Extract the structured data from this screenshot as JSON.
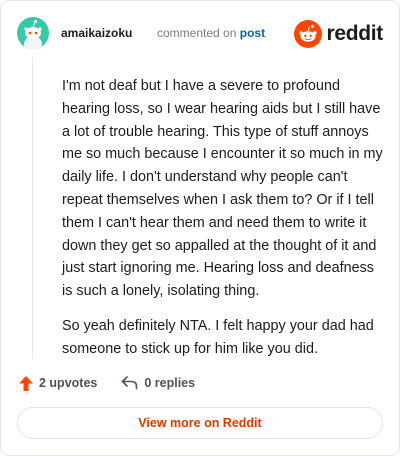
{
  "comment": {
    "author": "amaikaizoku",
    "action_text": "commented on",
    "post_link_label": "post",
    "paragraphs": [
      "I'm not deaf but I have a severe to profound hearing loss, so I wear hearing aids but I still have a lot of trouble hearing. This type of stuff annoys me so much because I encounter it so much in my daily life. I don't understand why people can't repeat themselves when I ask them to? Or if I tell them I can't hear them and need them to write it down they get so appalled at the thought of it and just start ignoring me. Hearing loss and deafness is such a lonely, isolating thing.",
      "So yeah definitely NTA. I felt happy your dad had someone to stick up for him like you did."
    ],
    "upvotes_label": "2 upvotes",
    "replies_label": "0 replies"
  },
  "brand": {
    "name": "reddit",
    "icon": "reddit-snoo-icon",
    "color": "#ff4500"
  },
  "avatar": {
    "icon": "snoo-avatar",
    "color": "#34c9a7"
  },
  "view_more_label": "View more on Reddit",
  "colors": {
    "upvote": "#ff4500",
    "link": "#0a5ea8",
    "view_more": "#d93a00"
  }
}
